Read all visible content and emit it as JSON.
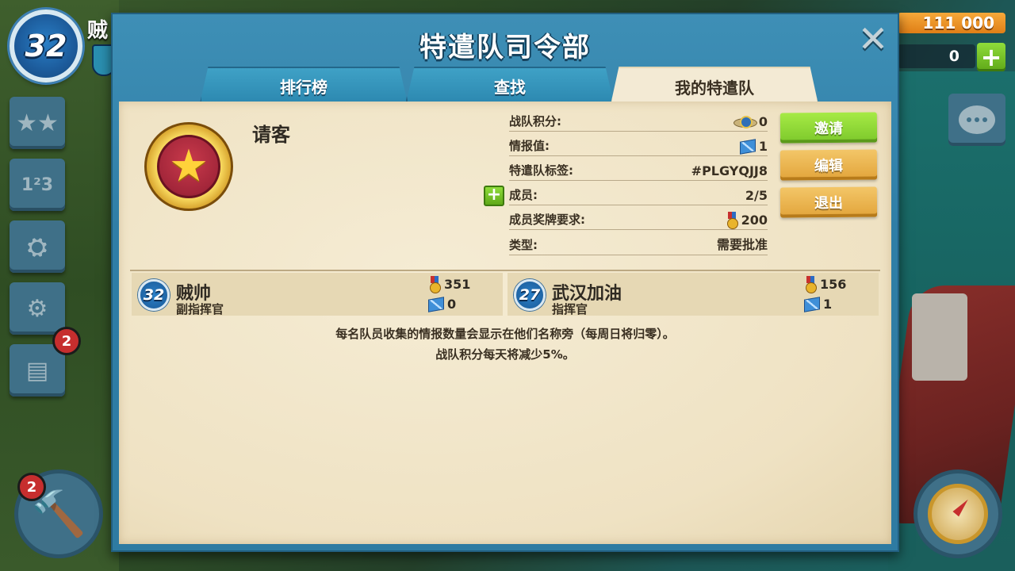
{
  "hud": {
    "player_level": "32",
    "player_name_partial": "贼",
    "gold": "111 000",
    "diamonds": "0",
    "plus_label": "+",
    "notifications": {
      "news": "2",
      "build": "2"
    }
  },
  "panel": {
    "title": "特遣队司令部",
    "tabs": [
      {
        "label": "排行榜",
        "active": false
      },
      {
        "label": "查找",
        "active": false
      },
      {
        "label": "我的特遣队",
        "active": true
      }
    ]
  },
  "team": {
    "name": "请客",
    "stats": [
      {
        "label": "战队积分:",
        "value": "0",
        "icon": "wings-icon"
      },
      {
        "label": "情报值:",
        "value": "1",
        "icon": "intel-icon"
      },
      {
        "label": "特遣队标签:",
        "value": "#PLGYQJJ8",
        "icon": ""
      },
      {
        "label": "成员:",
        "value": "2/5",
        "icon": ""
      },
      {
        "label": "成员奖牌要求:",
        "value": "200",
        "icon": "medal-icon"
      },
      {
        "label": "类型:",
        "value": "需要批准",
        "icon": ""
      }
    ],
    "buttons": {
      "invite": "邀请",
      "edit": "编辑",
      "leave": "退出"
    }
  },
  "members": [
    {
      "level": "32",
      "name": "贼帅",
      "role": "副指挥官",
      "medals": "351",
      "intel": "0"
    },
    {
      "level": "27",
      "name": "武汉加油",
      "role": "指挥官",
      "medals": "156",
      "intel": "1"
    }
  ],
  "notes": {
    "line1": "每名队员收集的情报数量会显示在他们名称旁（每周日将归零）。",
    "line2": "战队积分每天将减少5%。"
  },
  "colors": {
    "panel_blue": "#2f7ea6",
    "paper": "#f1e6c9",
    "invite_green": "#7cc82b",
    "action_gold": "#e2a43a",
    "gold_bar": "#e07f17"
  }
}
